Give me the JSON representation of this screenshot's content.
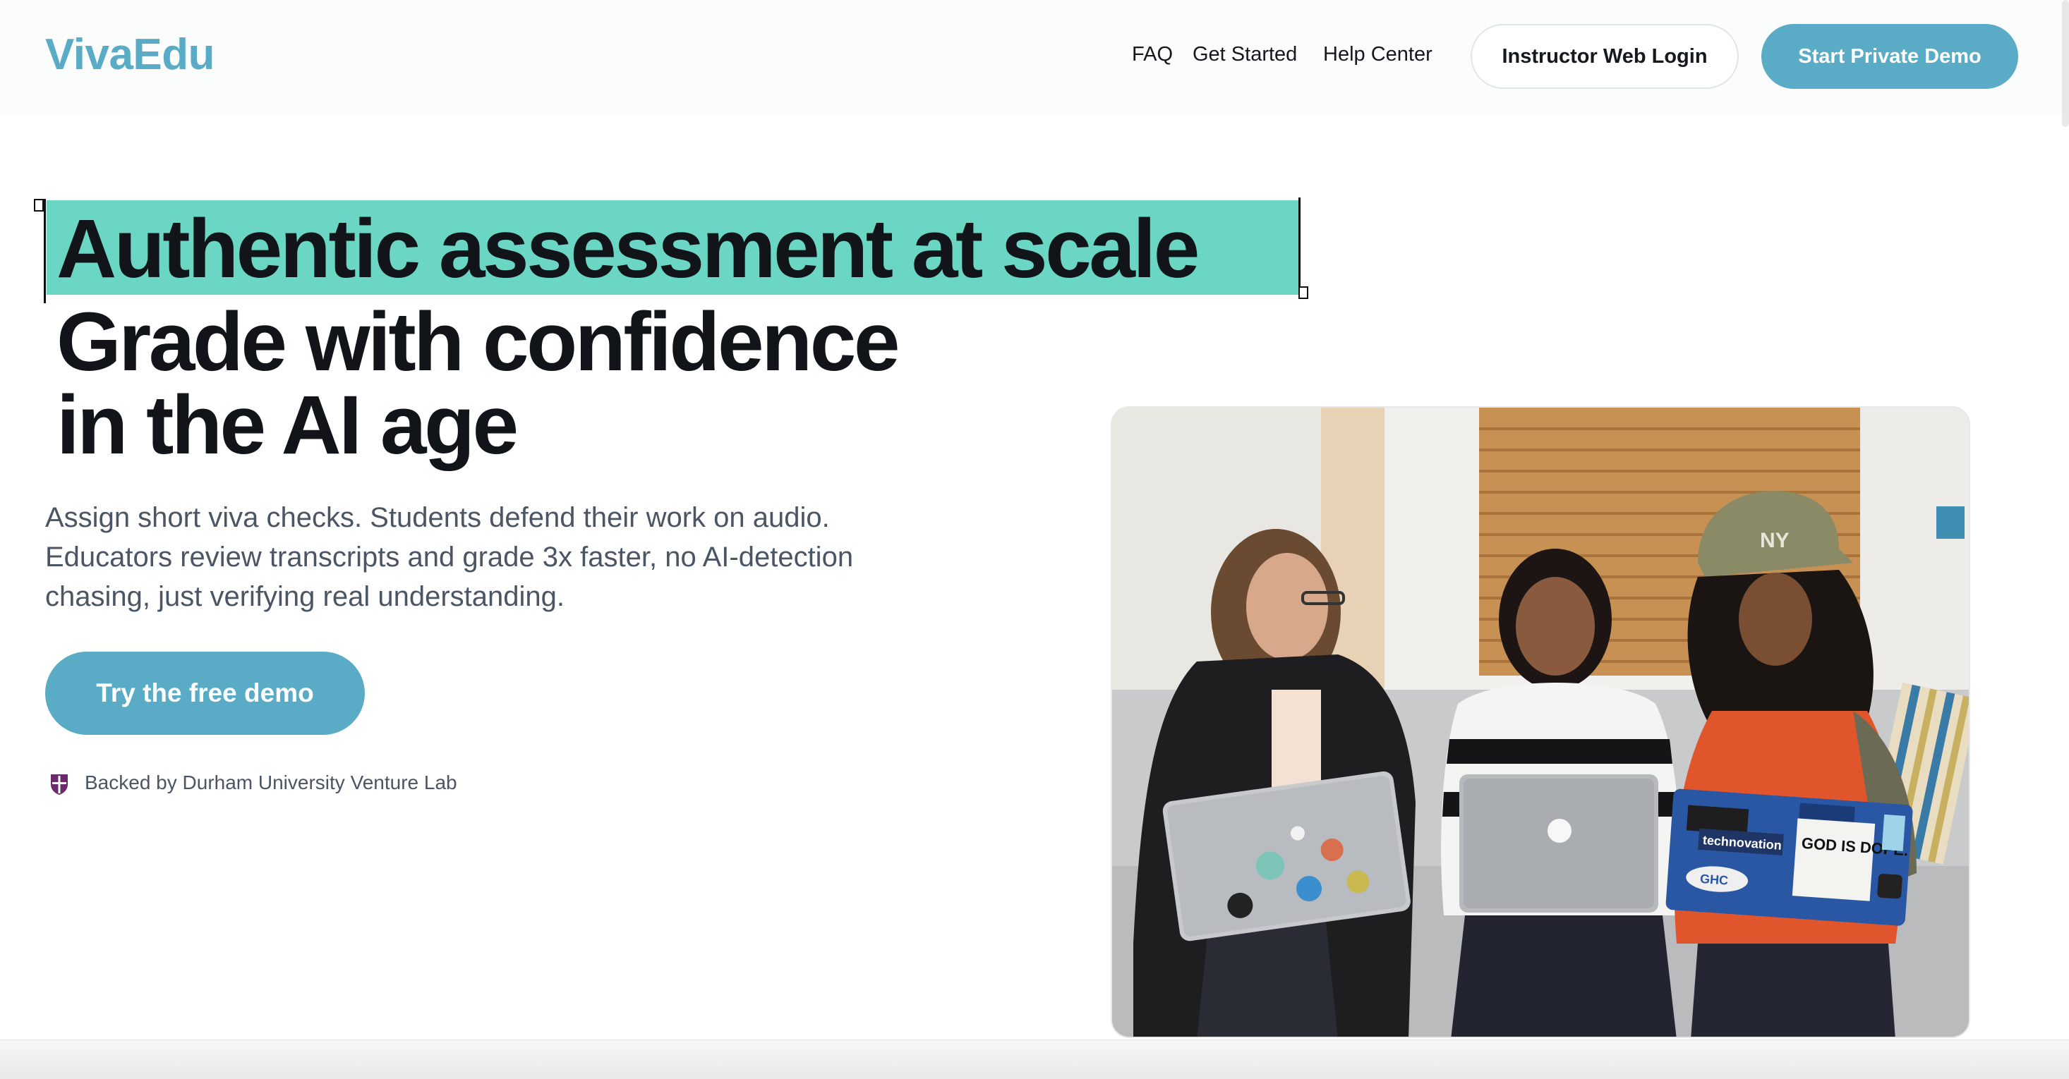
{
  "nav": {
    "logo": "VivaEdu",
    "links": [
      "FAQ",
      "Get Started",
      "Help Center"
    ],
    "login_label": "Instructor Web Login",
    "demo_label": "Start Private Demo"
  },
  "hero": {
    "highlight_line": "Authentic assessment at scale",
    "title_line_2": "Grade with confidence",
    "title_line_3": "in the AI age",
    "lead": "Assign short viva checks. Students defend their work on audio. Educators review transcripts and grade 3x faster, no AI-detection chasing, just verifying real understanding.",
    "cta_label": "Try the free demo",
    "backed_text": "Backed by Durham University Venture Lab",
    "backed_icon": "shield-crest-icon"
  },
  "photo": {
    "laptop_stickers": [
      "GOD IS DOPE.",
      "technovation",
      "GHC"
    ],
    "cap_logo": "NY"
  },
  "colors": {
    "brand": "#5aabc6",
    "highlight": "#6ad6c3",
    "text_dark": "#111418",
    "text_muted": "#4c5563"
  }
}
